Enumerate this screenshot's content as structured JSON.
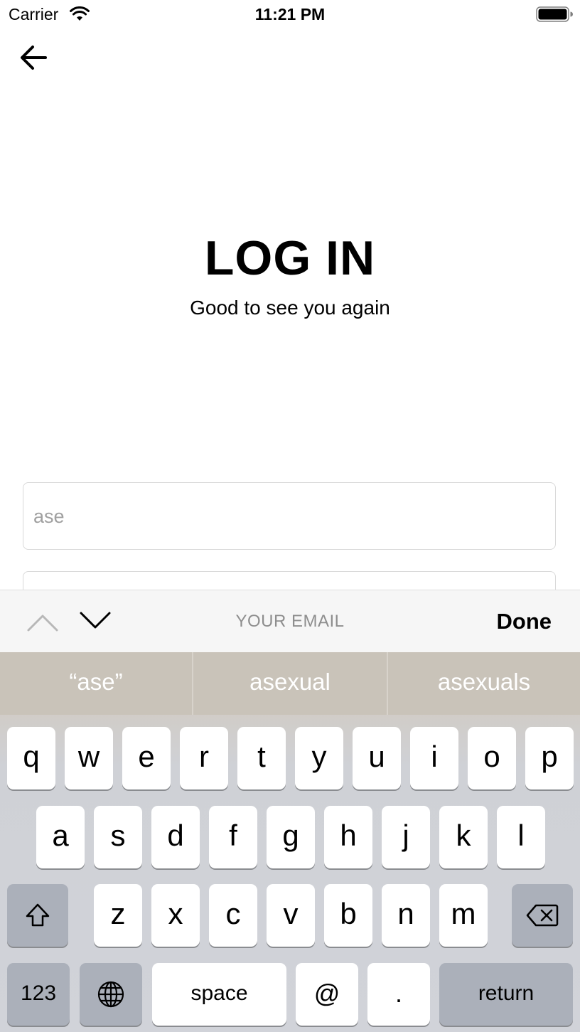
{
  "status_bar": {
    "carrier": "Carrier",
    "time": "11:21 PM",
    "icons": [
      "wifi-icon",
      "battery-icon"
    ]
  },
  "nav": {
    "back_icon": "arrow-left-icon"
  },
  "header": {
    "title": "LOG IN",
    "subtitle": "Good to see you again"
  },
  "form": {
    "email_placeholder": "ase",
    "email_value": ""
  },
  "accessory": {
    "field_name": "YOUR EMAIL",
    "done_label": "Done",
    "icons": [
      "chevron-up-icon",
      "chevron-down-icon"
    ]
  },
  "keyboard": {
    "suggestions": [
      "“ase”",
      "asexual",
      "asexuals"
    ],
    "row1": [
      "q",
      "w",
      "e",
      "r",
      "t",
      "y",
      "u",
      "i",
      "o",
      "p"
    ],
    "row2": [
      "a",
      "s",
      "d",
      "f",
      "g",
      "h",
      "j",
      "k",
      "l"
    ],
    "row3": [
      "z",
      "x",
      "c",
      "v",
      "b",
      "n",
      "m"
    ],
    "numbers_label": "123",
    "space_label": "space",
    "at_label": "@",
    "period_label": ".",
    "return_label": "return",
    "icons": [
      "shift-icon",
      "delete-icon",
      "globe-icon"
    ]
  }
}
